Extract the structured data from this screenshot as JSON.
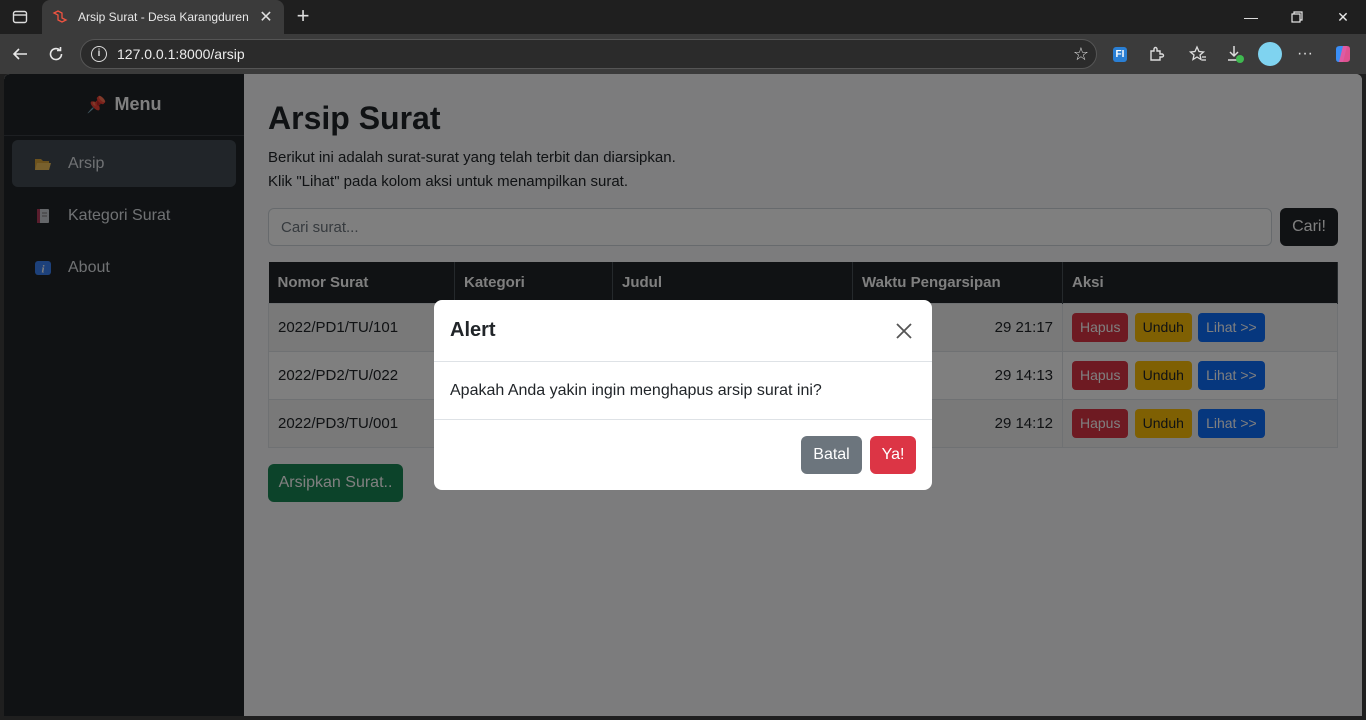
{
  "browser": {
    "tab_title": "Arsip Surat - Desa Karangduren",
    "url": "127.0.0.1:8000/arsip"
  },
  "sidebar": {
    "heading": "Menu",
    "items": [
      {
        "label": "Arsip",
        "icon": "folder-icon",
        "active": true
      },
      {
        "label": "Kategori Surat",
        "icon": "notebook-icon",
        "active": false
      },
      {
        "label": "About",
        "icon": "info-icon",
        "active": false
      }
    ]
  },
  "main": {
    "title": "Arsip Surat",
    "desc_line1": "Berikut ini adalah surat-surat yang telah terbit dan diarsipkan.",
    "desc_line2": "Klik \"Lihat\" pada kolom aksi untuk menampilkan surat.",
    "search_placeholder": "Cari surat...",
    "search_button": "Cari!",
    "table": {
      "headers": [
        "Nomor Surat",
        "Kategori",
        "Judul",
        "Waktu Pengarsipan",
        "Aksi"
      ],
      "rows": [
        {
          "nomor": "2022/PD1/TU/101",
          "waktu": "29 21:17"
        },
        {
          "nomor": "2022/PD2/TU/022",
          "waktu": "29 14:13"
        },
        {
          "nomor": "2022/PD3/TU/001",
          "waktu": "29 14:12"
        }
      ],
      "action_labels": {
        "hapus": "Hapus",
        "unduh": "Unduh",
        "lihat": "Lihat >>"
      }
    },
    "archive_button": "Arsipkan Surat.."
  },
  "modal": {
    "title": "Alert",
    "message": "Apakah Anda yakin ingin menghapus arsip surat ini?",
    "cancel_label": "Batal",
    "confirm_label": "Ya!"
  },
  "colors": {
    "sidebar_bg": "#212529",
    "danger": "#dc3545",
    "warning": "#ffc107",
    "primary": "#0d6efd",
    "success": "#198754",
    "secondary": "#6c757d"
  }
}
